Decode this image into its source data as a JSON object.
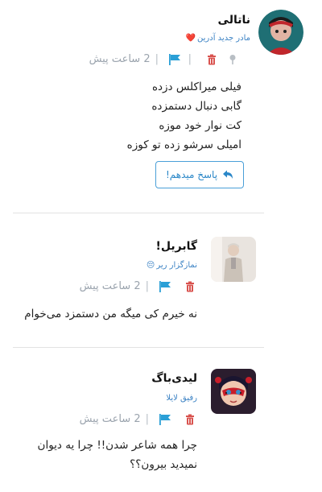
{
  "comments": [
    {
      "name": "ناتالی",
      "badge": "مادر جدید آدرین",
      "badge_emoji": "❤️",
      "time": "2 ساعت پیش",
      "lines": [
        "فیلی میراکلس دزده",
        "گابی دنبال دستمزده",
        "کت نوار خود موزه",
        "امیلی سرشو زده تو کوزه"
      ],
      "reply_label": "پاسخ میدهم!",
      "icons": [
        "pin-icon",
        "trash-icon",
        "flag-icon"
      ]
    },
    {
      "name": "گابریل!",
      "badge": "نمازگزار ریر",
      "badge_emoji": "😔",
      "time": "2 ساعت پیش",
      "lines": [
        "نه خیرم کی میگه من دستمزد می‌خوام"
      ],
      "icons": [
        "trash-icon",
        "flag-icon"
      ]
    },
    {
      "name": "لیدی‌باگ",
      "badge": "رفیق لایلا",
      "time": "2 ساعت پیش",
      "lines": [
        "چرا همه شاعر شدن!! چرا یه دیوان",
        "نمیدید بیرون؟؟"
      ],
      "icons": [
        "trash-icon",
        "flag-icon"
      ]
    }
  ],
  "colors": {
    "accent": "#3b82c4",
    "trash": "#d9534f",
    "flag": "#2a9fd6",
    "meta": "#9aa3ad"
  }
}
